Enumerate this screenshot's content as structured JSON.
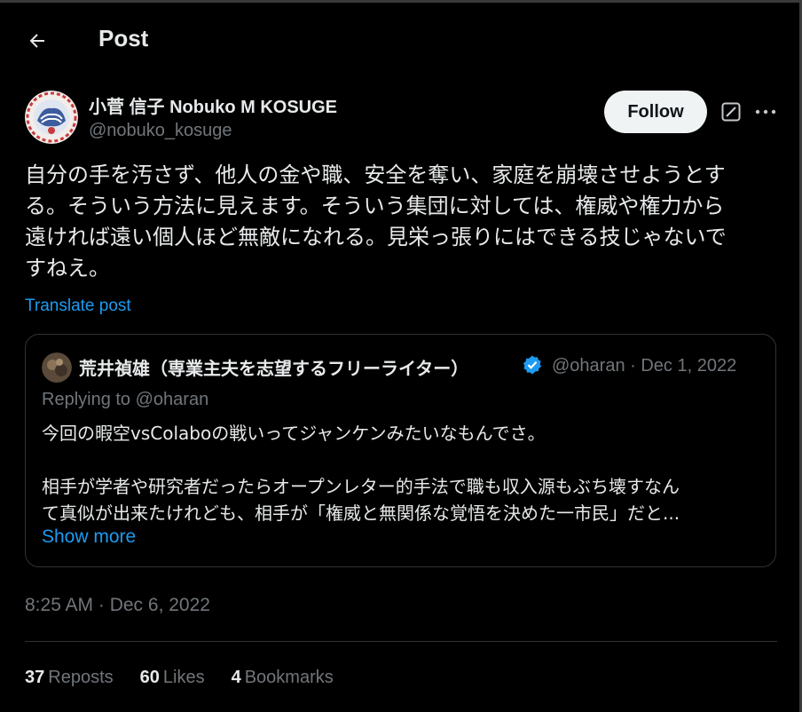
{
  "header": {
    "title": "Post",
    "back_icon": "arrow-left-icon"
  },
  "author": {
    "name": "小菅 信子 Nobuko M KOSUGE",
    "handle": "@nobuko_kosuge",
    "follow_label": "Follow",
    "grok_icon": "grok-icon",
    "more_icon": "more-dots-icon"
  },
  "post": {
    "text_lines": [
      "自分の手を汚さず、他人の金や職、安全を奪い、家庭を崩壊させようとす",
      "る。そういう方法に見えます。そういう集団に対しては、権威や権力から",
      "遠ければ遠い個人ほど無敵になれる。見栄っ張りにはできる技じゃないで",
      "すねえ。"
    ],
    "translate_label": "Translate post"
  },
  "quote": {
    "name": "荒井禎雄（専業主夫を志望するフリーライター）",
    "verified_icon": "verified-badge-icon",
    "handle_date": "@oharan · Dec 1, 2022",
    "replying_to": "Replying to @oharan",
    "line1": "今回の暇空vsColaboの戦いってジャンケンみたいなもんでさ。",
    "line2": "相手が学者や研究者だったらオープンレター的手法で職も収入源もぶち壊すなん",
    "line3": "て真似が出来たけれども、相手が「権威と無関係な覚悟を決めた一市民」だと...",
    "show_more": "Show more"
  },
  "meta": {
    "timestamp": "8:25 AM · Dec 6, 2022"
  },
  "stats": {
    "reposts_count": "37",
    "reposts_label": "Reposts",
    "likes_count": "60",
    "likes_label": "Likes",
    "bookmarks_count": "4",
    "bookmarks_label": "Bookmarks"
  },
  "colors": {
    "background": "#000000",
    "text": "#e7e9ea",
    "muted": "#71767b",
    "accent": "#1d9bf0",
    "border": "#2f3336"
  }
}
